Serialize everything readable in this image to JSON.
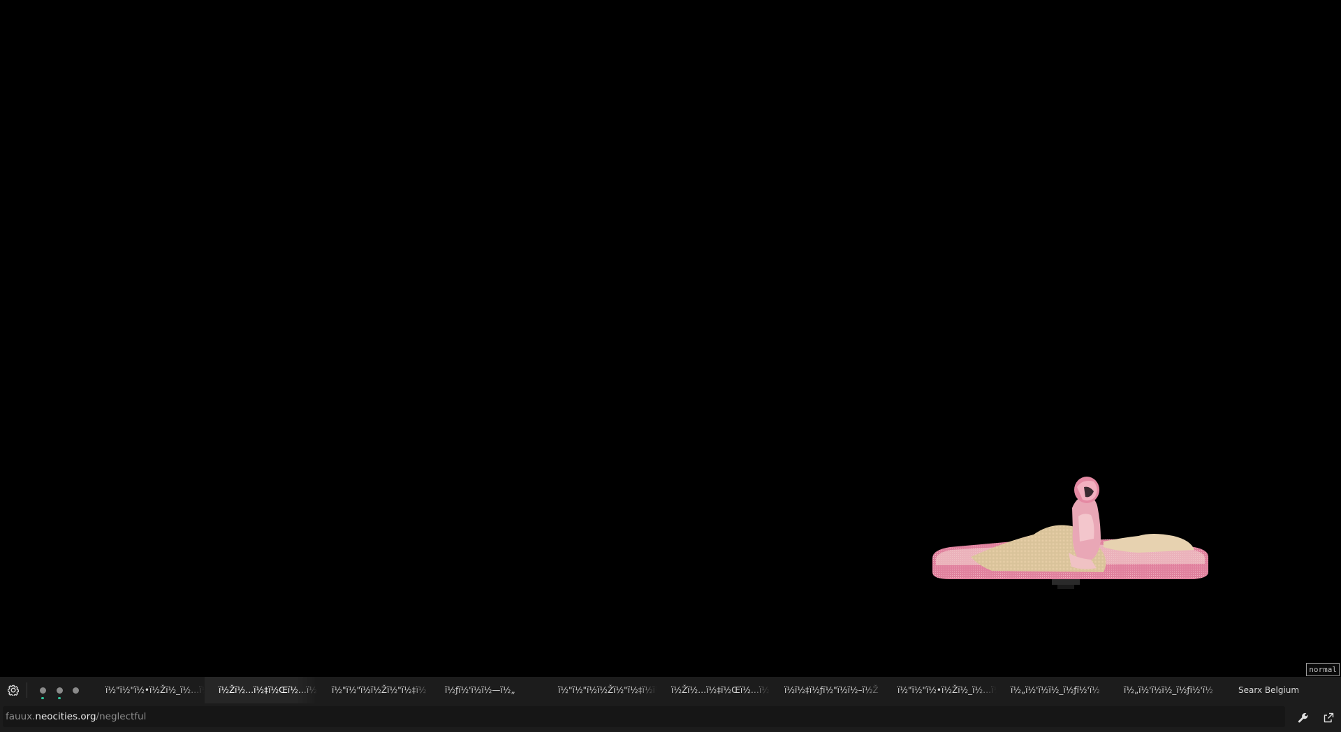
{
  "page": {
    "background": "#000000",
    "artwork": "anime girl in pink dress sitting on a bed, dithered pixel art"
  },
  "mode_badge": "normal",
  "tabbar": {
    "settings_icon": "gear-icon",
    "dots": [
      {
        "indicator": true
      },
      {
        "indicator": true
      },
      {
        "indicator": false
      }
    ],
    "tabs": [
      {
        "title": "ï½\"ï½\"ï½•ï½Žï½_ï½…ï½",
        "active": false
      },
      {
        "title": "ï½Žï½…ï½‡ï½Œï½…ï½",
        "active": true
      },
      {
        "title": "ï½\"ï½\"ï½ï½Žï½\"ï½‡ï½",
        "active": false
      },
      {
        "title": "ï½ƒï½'ï½ï½—ï½„",
        "active": false
      },
      {
        "title": "ï½\"ï½\"ï½ï½Žï½\"ï½‡ï½ï½",
        "active": false
      },
      {
        "title": "ï½Žï½…ï½‡ï½Œï½…ï½",
        "active": false
      },
      {
        "title": "ï½ï½‡ï½ƒï½\"ï½ï½–ï½Ž",
        "active": false
      },
      {
        "title": "ï½\"ï½\"ï½•ï½Žï½_ï½…ï½",
        "active": false
      },
      {
        "title": "ï½„ï½'ï½ï½_ï½ƒï½'ï½",
        "active": false
      },
      {
        "title": "ï½„ï½'ï½ï½_ï½ƒï½'ï½",
        "active": false
      },
      {
        "title": "Searx Belgium",
        "active": false
      }
    ],
    "accent_color": "#2fc59b"
  },
  "urlbar": {
    "url_prefix": "fauux.",
    "url_host": "neocities.org",
    "url_path": "/neglectful",
    "tools_icon": "wrench-icon",
    "share_icon": "share-icon"
  }
}
